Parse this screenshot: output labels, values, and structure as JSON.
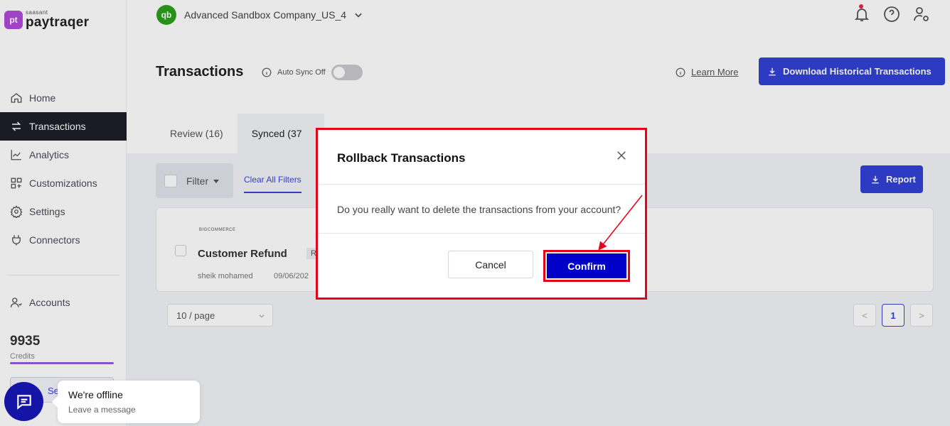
{
  "brand": {
    "mark": "pt",
    "small": "saasant",
    "name": "paytraqer",
    "color": "#b04ad8"
  },
  "header": {
    "company_logo": "qb",
    "company_name": "Advanced Sandbox Company_US_4",
    "icons": [
      "bell-icon",
      "help-icon",
      "user-settings-icon"
    ]
  },
  "sidebar": {
    "items": [
      {
        "label": "Home",
        "icon": "home-icon"
      },
      {
        "label": "Transactions",
        "icon": "transfer-icon",
        "active": true
      },
      {
        "label": "Analytics",
        "icon": "chart-icon"
      },
      {
        "label": "Customizations",
        "icon": "grid-icon"
      },
      {
        "label": "Settings",
        "icon": "gear-icon"
      },
      {
        "label": "Connectors",
        "icon": "plug-icon"
      }
    ],
    "accounts": {
      "label": "Accounts",
      "icon": "user-icon"
    },
    "credits": {
      "value": "9935",
      "label": "Credits"
    },
    "see_more_partial": "Se"
  },
  "page": {
    "title": "Transactions",
    "auto_sync_label": "Auto Sync Off",
    "learn_more": "Learn More",
    "download_btn": "Download Historical Transactions",
    "tabs": [
      {
        "label": "Review (16)"
      },
      {
        "label": "Synced (37",
        "active": true
      }
    ],
    "filter_label": "Filter",
    "clear_filters": "Clear All Filters",
    "report_btn": "Report",
    "transaction": {
      "source_logo": "BIGCOMMERCE",
      "title": "Customer Refund",
      "tag": "Re",
      "user": "sheik mohamed",
      "date": "09/06/202"
    },
    "page_size": "10 / page",
    "pagination": {
      "prev": "<",
      "current": "1",
      "next": ">"
    }
  },
  "modal": {
    "title": "Rollback Transactions",
    "body": "Do you really want to delete the transactions from your account?",
    "cancel": "Cancel",
    "confirm": "Confirm"
  },
  "chat": {
    "title": "We're offline",
    "subtitle": "Leave a message"
  },
  "colors": {
    "primary": "#3240d6",
    "confirm": "#0000c8",
    "highlight": "#e3061a",
    "chat": "#1415a6"
  }
}
